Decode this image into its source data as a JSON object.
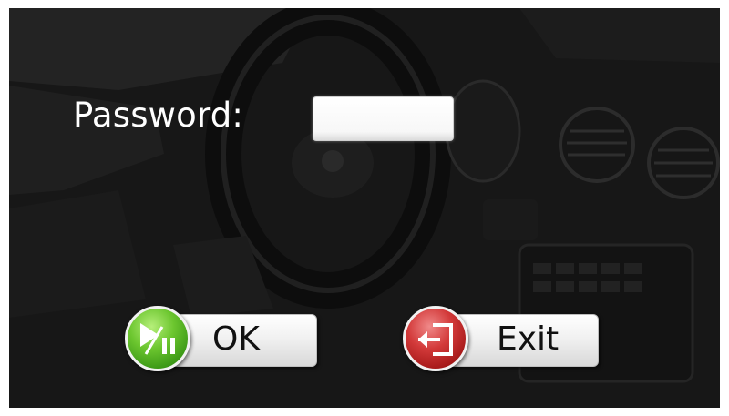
{
  "login": {
    "password_label": "Password:",
    "password_value": ""
  },
  "buttons": {
    "ok_label": "OK",
    "exit_label": "Exit",
    "ok_icon": "play-pause-icon",
    "exit_icon": "exit-door-icon"
  },
  "colors": {
    "ok_accent": "#5cb82a",
    "exit_accent": "#c42a2a"
  }
}
